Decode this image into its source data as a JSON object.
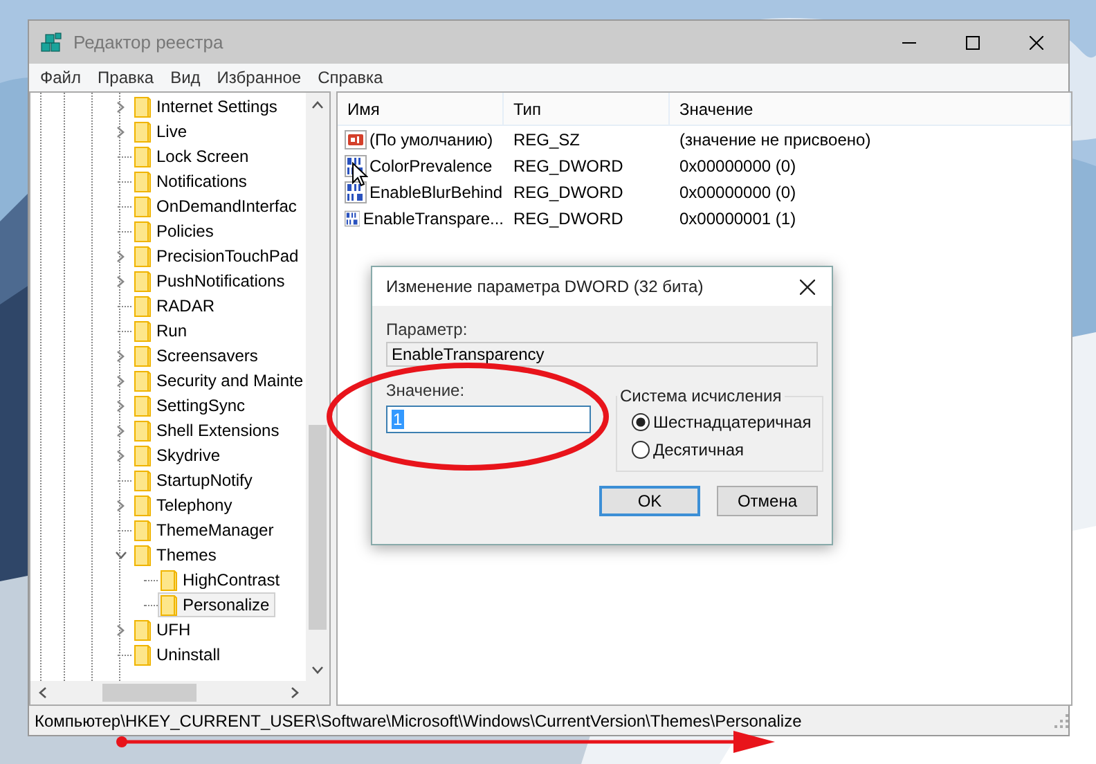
{
  "window": {
    "title": "Редактор реестра"
  },
  "menu": [
    "Файл",
    "Правка",
    "Вид",
    "Избранное",
    "Справка"
  ],
  "tree": [
    {
      "label": "Internet Settings",
      "kind": "branch",
      "expanded": false,
      "selected": false
    },
    {
      "label": "Live",
      "kind": "branch",
      "expanded": false,
      "selected": false
    },
    {
      "label": "Lock Screen",
      "kind": "leaf",
      "selected": false
    },
    {
      "label": "Notifications",
      "kind": "leaf",
      "selected": false
    },
    {
      "label": "OnDemandInterfac",
      "kind": "leaf",
      "selected": false
    },
    {
      "label": "Policies",
      "kind": "leaf",
      "selected": false
    },
    {
      "label": "PrecisionTouchPad",
      "kind": "branch",
      "expanded": false,
      "selected": false
    },
    {
      "label": "PushNotifications",
      "kind": "branch",
      "expanded": false,
      "selected": false
    },
    {
      "label": "RADAR",
      "kind": "leaf",
      "selected": false
    },
    {
      "label": "Run",
      "kind": "leaf",
      "selected": false
    },
    {
      "label": "Screensavers",
      "kind": "branch",
      "expanded": false,
      "selected": false
    },
    {
      "label": "Security and Mainte",
      "kind": "branch",
      "expanded": false,
      "selected": false
    },
    {
      "label": "SettingSync",
      "kind": "branch",
      "expanded": false,
      "selected": false
    },
    {
      "label": "Shell Extensions",
      "kind": "branch",
      "expanded": false,
      "selected": false
    },
    {
      "label": "Skydrive",
      "kind": "branch",
      "expanded": false,
      "selected": false
    },
    {
      "label": "StartupNotify",
      "kind": "leaf",
      "selected": false
    },
    {
      "label": "Telephony",
      "kind": "branch",
      "expanded": false,
      "selected": false
    },
    {
      "label": "ThemeManager",
      "kind": "leaf",
      "selected": false
    },
    {
      "label": "Themes",
      "kind": "branch",
      "expanded": true,
      "selected": false,
      "children": [
        {
          "label": "HighContrast",
          "kind": "leaf",
          "selected": false
        },
        {
          "label": "Personalize",
          "kind": "leaf",
          "selected": true
        }
      ]
    },
    {
      "label": "UFH",
      "kind": "branch",
      "expanded": false,
      "selected": false
    },
    {
      "label": "Uninstall",
      "kind": "leaf",
      "selected": false
    }
  ],
  "table": {
    "columns": [
      "Имя",
      "Тип",
      "Значение"
    ],
    "rows": [
      {
        "kind": "string",
        "name": "(По умолчанию)",
        "type": "REG_SZ",
        "data": "(значение не присвоено)"
      },
      {
        "kind": "dword",
        "name": "ColorPrevalence",
        "type": "REG_DWORD",
        "data": "0x00000000 (0)"
      },
      {
        "kind": "dword",
        "name": "EnableBlurBehind",
        "type": "REG_DWORD",
        "data": "0x00000000 (0)"
      },
      {
        "kind": "dword",
        "name": "EnableTranspare...",
        "type": "REG_DWORD",
        "data": "0x00000001 (1)"
      }
    ]
  },
  "status_bar": "Компьютер\\HKEY_CURRENT_USER\\Software\\Microsoft\\Windows\\CurrentVersion\\Themes\\Personalize",
  "dialog": {
    "title": "Изменение параметра DWORD (32 бита)",
    "name_label": "Параметр:",
    "name_value": "EnableTransparency",
    "value_label": "Значение:",
    "value": "1",
    "base_group": "Система исчисления",
    "bases": [
      {
        "label": "Шестнадцатеричная",
        "selected": true
      },
      {
        "label": "Десятичная",
        "selected": false
      }
    ],
    "buttons": [
      {
        "label": "OK",
        "default": true
      },
      {
        "label": "Отмена",
        "default": false
      }
    ]
  }
}
